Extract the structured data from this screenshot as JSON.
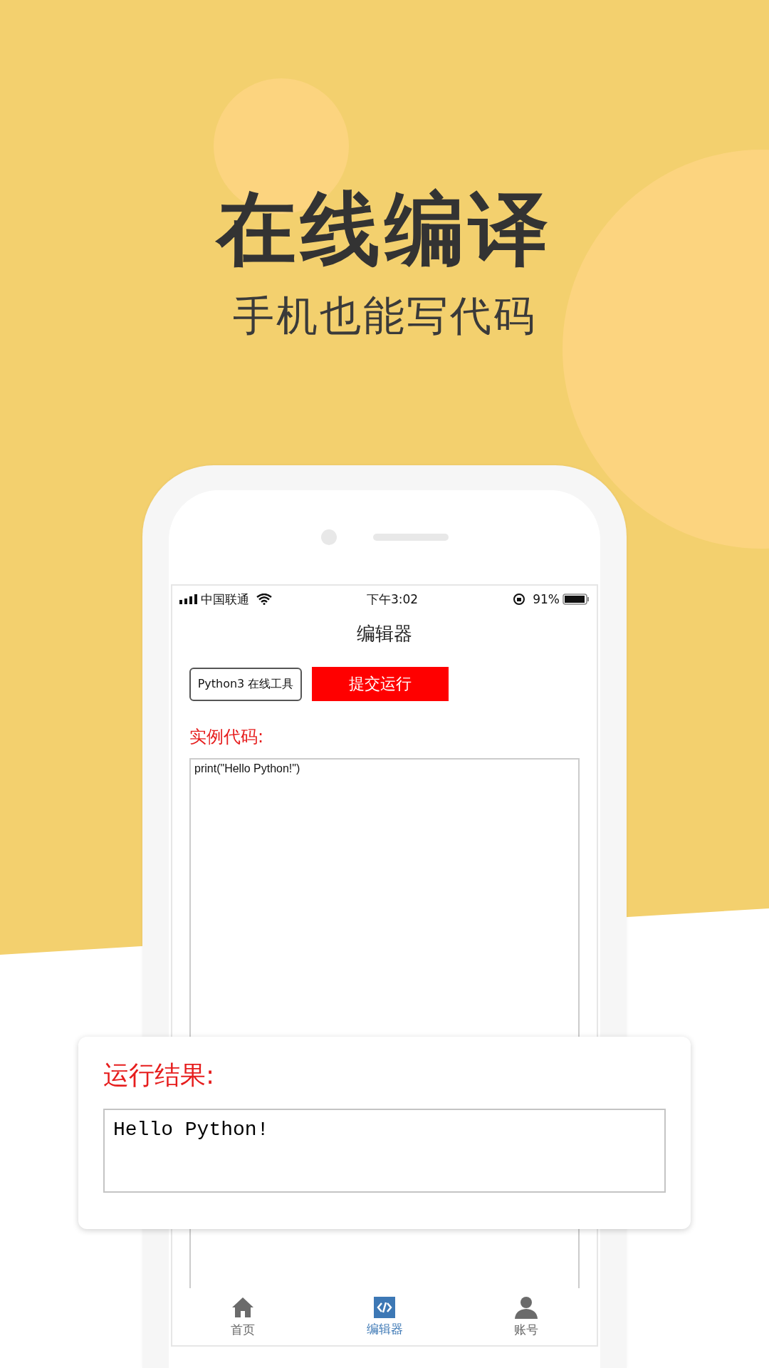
{
  "headline": "在线编译",
  "subtitle": "手机也能写代码",
  "status_bar": {
    "carrier": "中国联通",
    "time": "下午3:02",
    "battery": "91%"
  },
  "nav_title": "编辑器",
  "tool_label": "Python3 在线工具",
  "run_button": "提交运行",
  "code_label": "实例代码:",
  "code": "print(\"Hello Python!\")",
  "result": {
    "label": "运行结果:",
    "output": "Hello Python!"
  },
  "tabs": [
    {
      "kind": "home",
      "label": "首页",
      "selected": false
    },
    {
      "kind": "code",
      "label": "编辑器",
      "selected": true
    },
    {
      "kind": "user",
      "label": "账号",
      "selected": false
    }
  ]
}
